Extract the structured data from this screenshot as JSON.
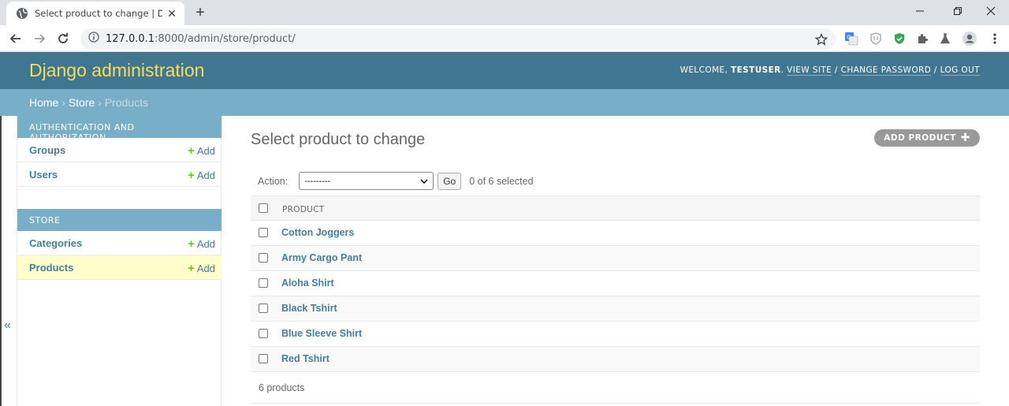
{
  "browser": {
    "tab_title": "Select product to change | Django",
    "url_host": "127.0.0.1",
    "url_path": ":8000/admin/store/product/"
  },
  "header": {
    "branding": "Django administration",
    "welcome": "WELCOME, ",
    "username": "TESTUSER",
    "view_site": "VIEW SITE",
    "change_password": "CHANGE PASSWORD",
    "log_out": "LOG OUT"
  },
  "breadcrumbs": {
    "home": "Home",
    "store": "Store",
    "current": "Products"
  },
  "sidebar": {
    "modules": [
      {
        "caption": "AUTHENTICATION AND AUTHORIZATION",
        "items": [
          {
            "name": "Groups",
            "add": "Add"
          },
          {
            "name": "Users",
            "add": "Add"
          }
        ]
      },
      {
        "caption": "STORE",
        "items": [
          {
            "name": "Categories",
            "add": "Add"
          },
          {
            "name": "Products",
            "add": "Add"
          }
        ]
      }
    ],
    "collapse_glyph": "«"
  },
  "content": {
    "title": "Select product to change",
    "add_button": "ADD PRODUCT",
    "action_label": "Action:",
    "action_selected": "---------",
    "go_button": "Go",
    "selection_counter": "0 of 6 selected",
    "column_header": "PRODUCT",
    "products": [
      "Cotton Joggers",
      "Army Cargo Pant",
      "Aloha Shirt",
      "Black Tshirt",
      "Blue Sleeve Shirt",
      "Red Tshirt"
    ],
    "paginator": "6 products"
  },
  "colors": {
    "header_bg": "#417690",
    "branding": "#f5dd5d",
    "breadcrumb_bg": "#79aec8",
    "link": "#447e9b",
    "add_plus": "#70bf2b",
    "current_row": "#ffffcc"
  }
}
